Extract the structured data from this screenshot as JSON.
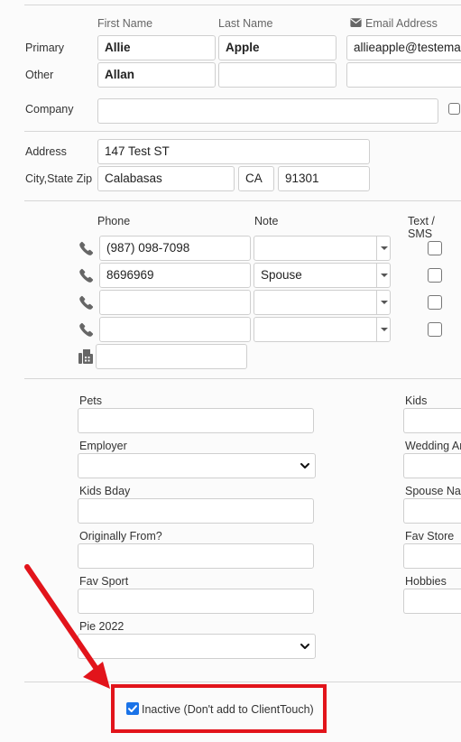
{
  "name_section": {
    "header_first": "First Name",
    "header_last": "Last Name",
    "header_email": "Email Address",
    "primary_label": "Primary",
    "other_label": "Other",
    "primary_first": "Allie",
    "primary_last": "Apple",
    "primary_email": "allieapple@testema",
    "other_first": "Allan",
    "other_last": "",
    "other_email": "",
    "company_label": "Company",
    "company_value": ""
  },
  "address_section": {
    "address_label": "Address",
    "address_value": "147 Test ST",
    "city_label": "City,State Zip",
    "city_value": "Calabasas",
    "state_value": "CA",
    "zip_value": "91301"
  },
  "phone_section": {
    "header_phone": "Phone",
    "header_note": "Note",
    "header_sms": "Text / SMS",
    "rows": [
      {
        "phone": "(987) 098-7098",
        "note": "",
        "sms": false
      },
      {
        "phone": "8696969",
        "note": "Spouse",
        "sms": false
      },
      {
        "phone": "",
        "note": "",
        "sms": false
      },
      {
        "phone": "",
        "note": "",
        "sms": false
      }
    ],
    "fax": ""
  },
  "custom_fields": {
    "left": [
      {
        "label": "Pets",
        "value": ""
      },
      {
        "label": "Employer",
        "value": ""
      },
      {
        "label": "Kids Bday",
        "value": ""
      },
      {
        "label": "Originally From?",
        "value": ""
      },
      {
        "label": "Fav Sport",
        "value": ""
      },
      {
        "label": "Pie 2022",
        "value": ""
      }
    ],
    "right": [
      {
        "label": "Kids",
        "value": ""
      },
      {
        "label": "Wedding An",
        "value": ""
      },
      {
        "label": "Spouse Nar",
        "value": ""
      },
      {
        "label": "Fav Store",
        "value": ""
      },
      {
        "label": "Hobbies",
        "value": ""
      }
    ]
  },
  "inactive": {
    "label": "Inactive (Don't add to ClientTouch)",
    "checked": true
  },
  "colors": {
    "annotation_red": "#e2141b",
    "checkbox_blue": "#1a73e8"
  },
  "icons": [
    "envelope-icon",
    "phone-icon",
    "fax-icon",
    "chevron-down-icon",
    "annotation-arrow"
  ]
}
